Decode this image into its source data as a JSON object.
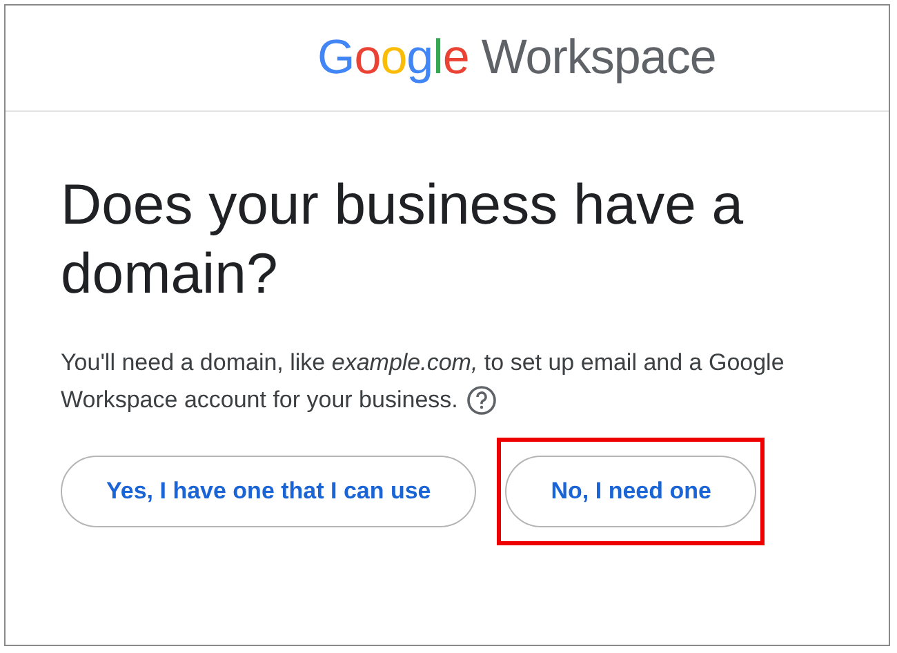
{
  "logo": {
    "brand": "Google",
    "product": "Workspace"
  },
  "heading": "Does your business have a domain?",
  "description_lines": [
    "You'll need a domain, like *example.com,* to set up email and a Google",
    "Workspace account for your business."
  ],
  "buttons": [
    {
      "label": "Yes, I have one that I can use",
      "highlighted": false
    },
    {
      "label": "No, I need one",
      "highlighted": true
    }
  ]
}
